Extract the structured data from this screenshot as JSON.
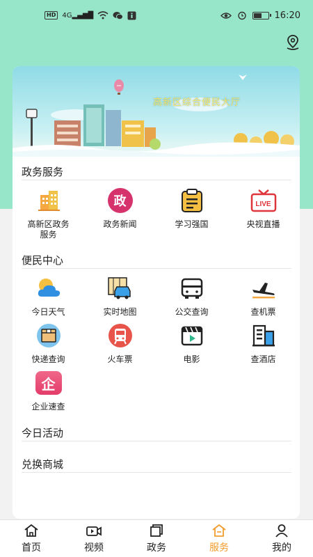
{
  "status_bar": {
    "network_left": "HD",
    "signal_label": "4G",
    "time": "16:20",
    "battery_level": 0.6
  },
  "header": {
    "location_icon": "location-pin-icon"
  },
  "banner": {
    "title": "高新区综合便民大厅"
  },
  "sections": {
    "gov_services": {
      "title": "政务服务",
      "items": [
        {
          "label": "高新区政务服务",
          "icon": "building-icon"
        },
        {
          "label": "政务新闻",
          "icon": "gov-news-icon",
          "badge": "政"
        },
        {
          "label": "学习强国",
          "icon": "clipboard-icon"
        },
        {
          "label": "央视直播",
          "icon": "live-tv-icon",
          "badge": "LIVE"
        }
      ]
    },
    "convenience": {
      "title": "便民中心",
      "items": [
        {
          "label": "今日天气",
          "icon": "weather-icon"
        },
        {
          "label": "实时地图",
          "icon": "map-car-icon"
        },
        {
          "label": "公交查询",
          "icon": "bus-icon"
        },
        {
          "label": "查机票",
          "icon": "airplane-icon"
        },
        {
          "label": "快递查询",
          "icon": "parcel-icon"
        },
        {
          "label": "火车票",
          "icon": "train-icon"
        },
        {
          "label": "电影",
          "icon": "movie-icon"
        },
        {
          "label": "查酒店",
          "icon": "hotel-icon"
        },
        {
          "label": "企业速查",
          "icon": "enterprise-icon",
          "badge": "企"
        }
      ]
    },
    "today_activity": {
      "title": "今日活动"
    },
    "exchange_mall": {
      "title": "兑换商城"
    }
  },
  "tabbar": {
    "active": "服务",
    "items": [
      {
        "label": "首页",
        "icon": "home-icon"
      },
      {
        "label": "视频",
        "icon": "video-icon"
      },
      {
        "label": "政务",
        "icon": "documents-icon"
      },
      {
        "label": "服务",
        "icon": "service-home-icon"
      },
      {
        "label": "我的",
        "icon": "profile-icon"
      }
    ]
  },
  "colors": {
    "mint": "#97e6c9",
    "accent": "#f39c2d"
  }
}
